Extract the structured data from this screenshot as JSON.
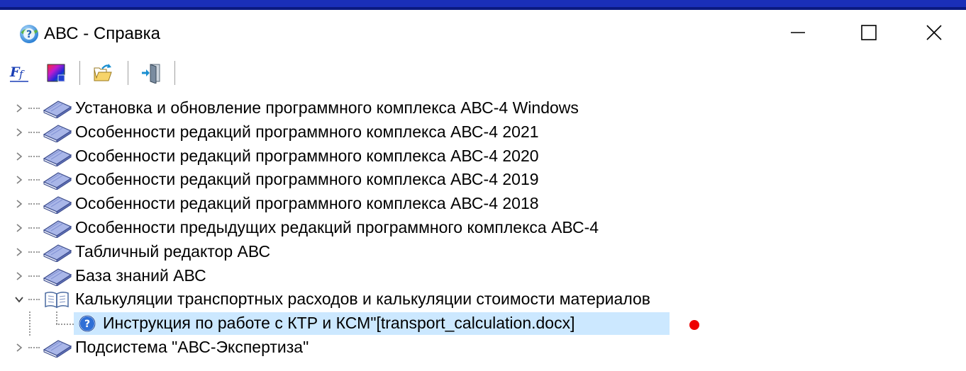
{
  "window": {
    "title": "АВС - Справка",
    "minimize_icon": "minimize-icon",
    "maximize_icon": "maximize-icon",
    "close_icon": "close-icon"
  },
  "toolbar": {
    "buttons": [
      {
        "name": "font-settings-button",
        "icon": "font-icon"
      },
      {
        "name": "color-settings-button",
        "icon": "color-palette-icon"
      },
      {
        "name": "open-file-button",
        "icon": "open-folder-icon"
      },
      {
        "name": "exit-button",
        "icon": "exit-door-icon"
      }
    ]
  },
  "tree": {
    "items": [
      {
        "label": "Установка и обновление программного комплекса АВС-4 Windows",
        "expanded": false
      },
      {
        "label": "Особенности редакций программного комплекса АВС-4 2021",
        "expanded": false
      },
      {
        "label": "Особенности редакций программного комплекса АВС-4 2020",
        "expanded": false
      },
      {
        "label": "Особенности редакций программного комплекса АВС-4 2019",
        "expanded": false
      },
      {
        "label": "Особенности редакций программного комплекса АВС-4 2018",
        "expanded": false
      },
      {
        "label": "Особенности предыдущих редакций программного комплекса АВС-4",
        "expanded": false
      },
      {
        "label": "Табличный редактор АВС",
        "expanded": false
      },
      {
        "label": "База знаний АВС",
        "expanded": false
      },
      {
        "label": "Калькуляции транспортных расходов и калькуляции стоимости материалов",
        "expanded": true
      },
      {
        "label": "Подсистема \"АВС-Экспертиза\"",
        "expanded": false
      }
    ],
    "child": {
      "label": "Инструкция по работе с КТР и КСМ\"[transport_calculation.docx]",
      "selected": true
    }
  },
  "colors": {
    "selection": "#cce8ff",
    "marker": "#ee0000"
  }
}
